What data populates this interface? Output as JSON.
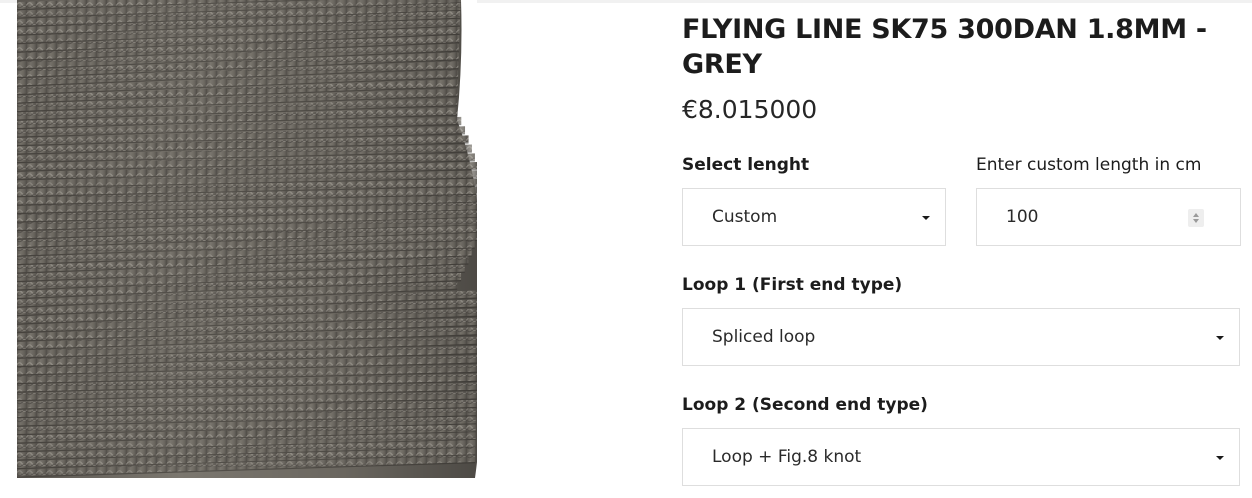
{
  "product": {
    "title": "FLYING LINE SK75 300DAN 1.8MM - GREY",
    "price": "€8.015000",
    "image_description": "grey braided rope coil"
  },
  "options": {
    "length_label": "Select lenght",
    "length_value": "Custom",
    "custom_length_label": "Enter custom length in cm",
    "custom_length_value": "100",
    "loop1_label": "Loop 1 (First end type)",
    "loop1_value": "Spliced loop",
    "loop2_label": "Loop 2 (Second end type)",
    "loop2_value": "Loop + Fig.8 knot"
  },
  "icons": {
    "dropdown": "chevron-down-icon",
    "stepper": "number-stepper-icon"
  },
  "colors": {
    "text": "#1c1c1c",
    "border": "#dedede",
    "rope": "#6e6a63"
  }
}
